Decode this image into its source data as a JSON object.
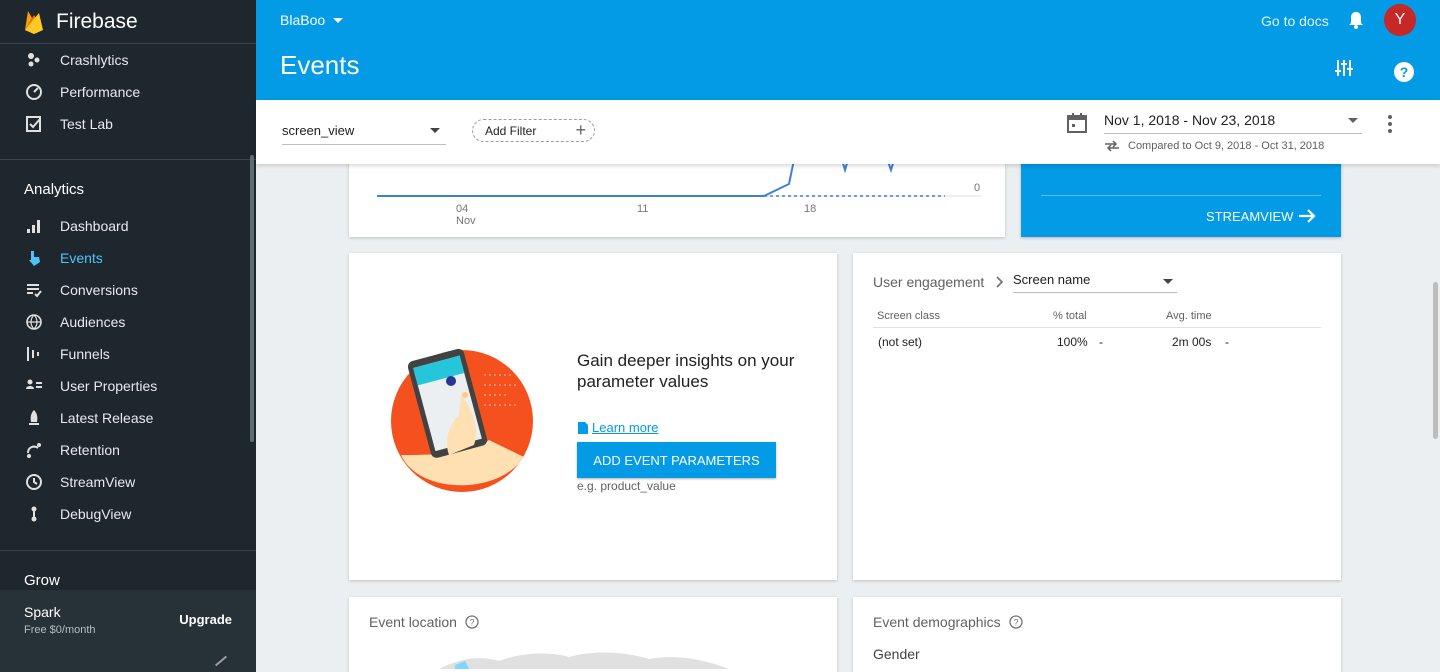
{
  "brand": {
    "name": "Firebase"
  },
  "sidebar": {
    "top_items": [
      {
        "label": "Crashlytics",
        "icon": "crashlytics-icon"
      },
      {
        "label": "Performance",
        "icon": "performance-icon"
      },
      {
        "label": "Test Lab",
        "icon": "test-lab-icon"
      }
    ],
    "section_analytics": "Analytics",
    "analytics_items": [
      {
        "label": "Dashboard",
        "icon": "dashboard-icon"
      },
      {
        "label": "Events",
        "icon": "events-icon",
        "active": true
      },
      {
        "label": "Conversions",
        "icon": "conversions-icon"
      },
      {
        "label": "Audiences",
        "icon": "audiences-icon"
      },
      {
        "label": "Funnels",
        "icon": "funnels-icon"
      },
      {
        "label": "User Properties",
        "icon": "user-properties-icon"
      },
      {
        "label": "Latest Release",
        "icon": "latest-release-icon"
      },
      {
        "label": "Retention",
        "icon": "retention-icon"
      },
      {
        "label": "StreamView",
        "icon": "streamview-icon"
      },
      {
        "label": "DebugView",
        "icon": "debugview-icon"
      }
    ],
    "section_grow": "Grow",
    "footer": {
      "plan": "Spark",
      "price": "Free $0/month",
      "upgrade": "Upgrade"
    }
  },
  "header": {
    "project": "BlaBoo",
    "title": "Events",
    "docs": "Go to docs",
    "avatar_letter": "Y"
  },
  "filters": {
    "event": "screen_view",
    "add_filter": "Add Filter",
    "date_range": "Nov 1, 2018 - Nov 23, 2018",
    "compared": "Compared to Oct 9, 2018 - Oct 31, 2018"
  },
  "chart_data": {
    "type": "line",
    "x_ticks": [
      "04",
      "11",
      "18"
    ],
    "x_sublabels": [
      "Nov",
      "",
      ""
    ],
    "y_tick": "0"
  },
  "streamview": {
    "label": "STREAMVIEW"
  },
  "promo": {
    "title": "Gain deeper insights on your parameter values",
    "learn_more": "Learn more",
    "button": "ADD EVENT PARAMETERS",
    "example": "e.g. product_value"
  },
  "engagement": {
    "title": "User engagement",
    "dimension": "Screen name",
    "columns": [
      "Screen class",
      "% total",
      "Avg. time"
    ],
    "rows": [
      {
        "screen_class": "(not set)",
        "pct_total": "100%",
        "pct_change": "-",
        "avg_time": "2m 00s",
        "time_change": "-"
      }
    ]
  },
  "location": {
    "title": "Event location"
  },
  "demographics": {
    "title": "Event demographics",
    "gender": "Gender"
  },
  "colors": {
    "accent": "#039be5",
    "sidebar": "#1e272e",
    "active": "#4fc3f7",
    "avatar": "#c62828"
  }
}
